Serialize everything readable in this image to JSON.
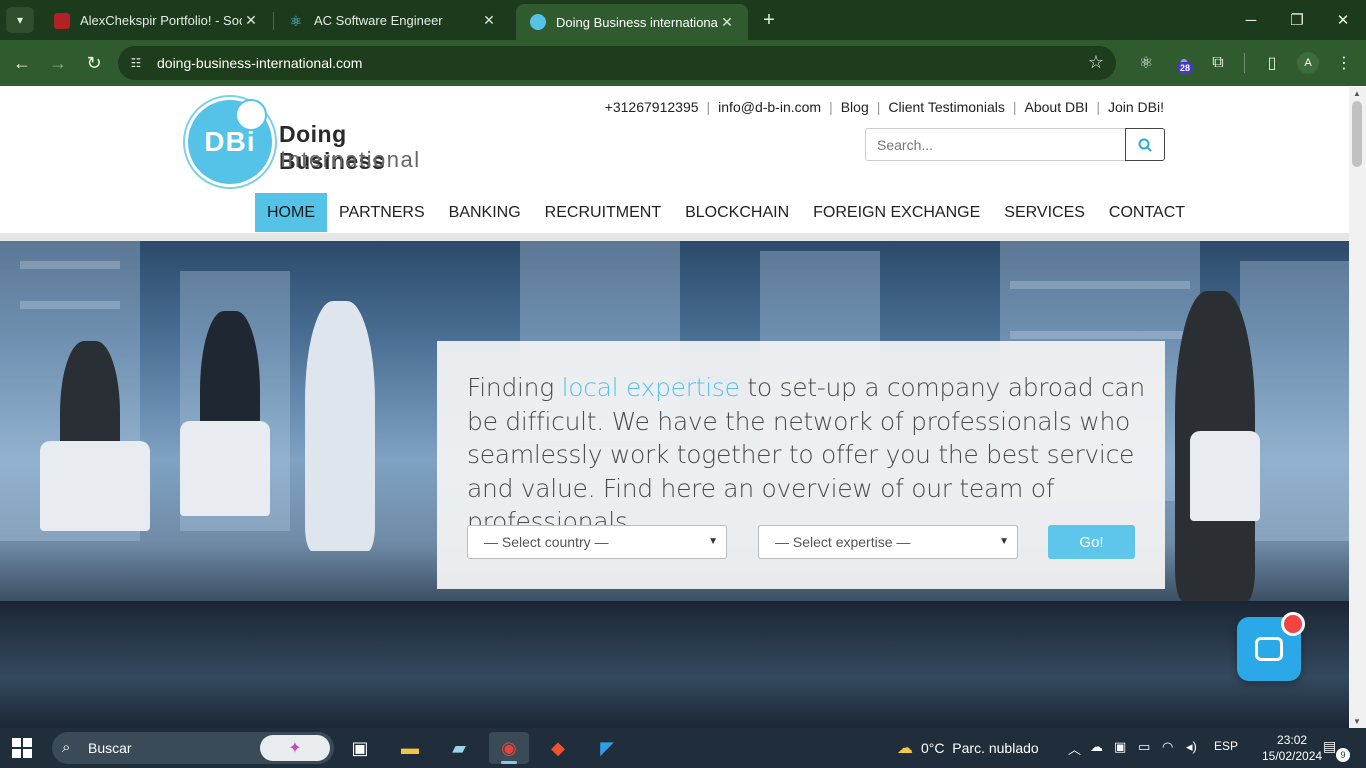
{
  "browser": {
    "tabs": [
      {
        "title": "AlexChekspir Portfolio! - Social",
        "favicon_color": "#b22222"
      },
      {
        "title": "AC Software Engineer",
        "favicon_color": "#61dafb"
      },
      {
        "title": "Doing Business international - D",
        "favicon_color": "#55c3e8"
      }
    ],
    "active_tab_index": 2,
    "url": "doing-business-international.com",
    "extension_badge": "28",
    "profile_initial": "A",
    "icons": {
      "tab_list": "chevron-down-icon",
      "new_tab": "plus-icon",
      "back": "arrow-left-icon",
      "forward": "arrow-right-icon",
      "reload": "reload-icon",
      "site_info": "tune-icon",
      "bookmark": "star-icon",
      "react_devtools": "atom-icon",
      "extensions": "puzzle-icon",
      "side_panel": "side-panel-icon",
      "menu": "kebab-icon"
    }
  },
  "site": {
    "logo": {
      "mark": "DBi",
      "title": "Doing Business",
      "subtitle": "International"
    },
    "top_links": [
      "+31267912395",
      "info@d-b-in.com",
      "Blog",
      "Client Testimonials",
      "About DBI",
      "Join DBi!"
    ],
    "search": {
      "placeholder": "Search...",
      "icon": "search-icon"
    },
    "nav": [
      "HOME",
      "PARTNERS",
      "BANKING",
      "RECRUITMENT",
      "BLOCKCHAIN",
      "FOREIGN EXCHANGE",
      "SERVICES",
      "CONTACT"
    ],
    "active_nav": "HOME",
    "hero": {
      "text_before": "Finding ",
      "text_highlight": "local expertise",
      "text_after": " to set-up a company abroad can be difficult. We have the network of professionals who seamlessly work together to offer you the best service and value. Find here an overview of our team of professionals.",
      "country_select": "— Select country —",
      "expertise_select": "— Select expertise —",
      "go_button": "Go!"
    },
    "colors": {
      "accent": "#55c3e8",
      "go_button": "#5ec6eb",
      "chat": "#2aa8e8"
    }
  },
  "taskbar": {
    "search_label": "Buscar",
    "weather": {
      "temp": "0°C",
      "condition": "Parc. nublado"
    },
    "language": "ESP",
    "time": "23:02",
    "date": "15/02/2024",
    "notification_count": "9"
  }
}
